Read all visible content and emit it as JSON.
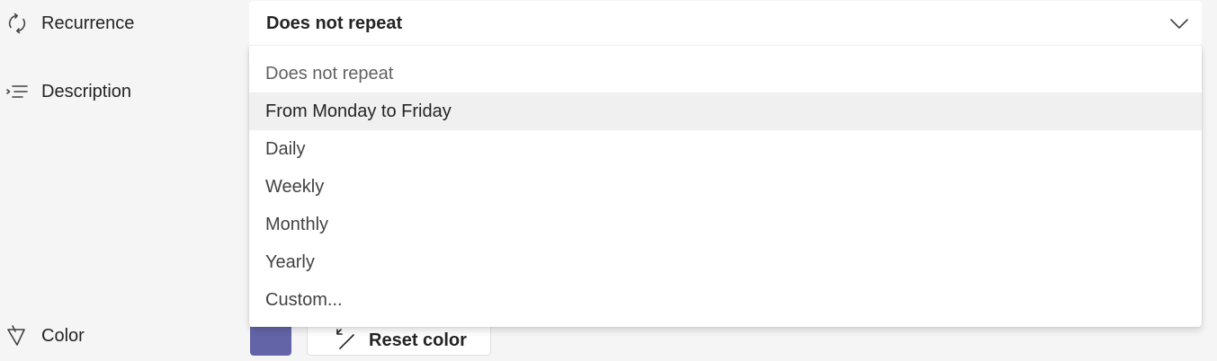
{
  "form": {
    "recurrence": {
      "label": "Recurrence",
      "icon": "recurrence-icon"
    },
    "description": {
      "label": "Description",
      "icon": "description-icon"
    },
    "color": {
      "label": "Color",
      "icon": "paint-bucket-icon"
    }
  },
  "recurrence_dropdown": {
    "selected_value": "Does not repeat",
    "options": [
      {
        "label": "Does not repeat"
      },
      {
        "label": "From Monday to Friday"
      },
      {
        "label": "Daily"
      },
      {
        "label": "Weekly"
      },
      {
        "label": "Monthly"
      },
      {
        "label": "Yearly"
      },
      {
        "label": "Custom..."
      }
    ],
    "hovered_option": "From Monday to Friday"
  },
  "color_controls": {
    "swatch_color": "#6264a7",
    "reset_label": "Reset color"
  },
  "theme": {
    "background": "#f5f5f5",
    "surface": "#ffffff",
    "hover": "#f0f0f0",
    "accent": "#6264a7"
  }
}
